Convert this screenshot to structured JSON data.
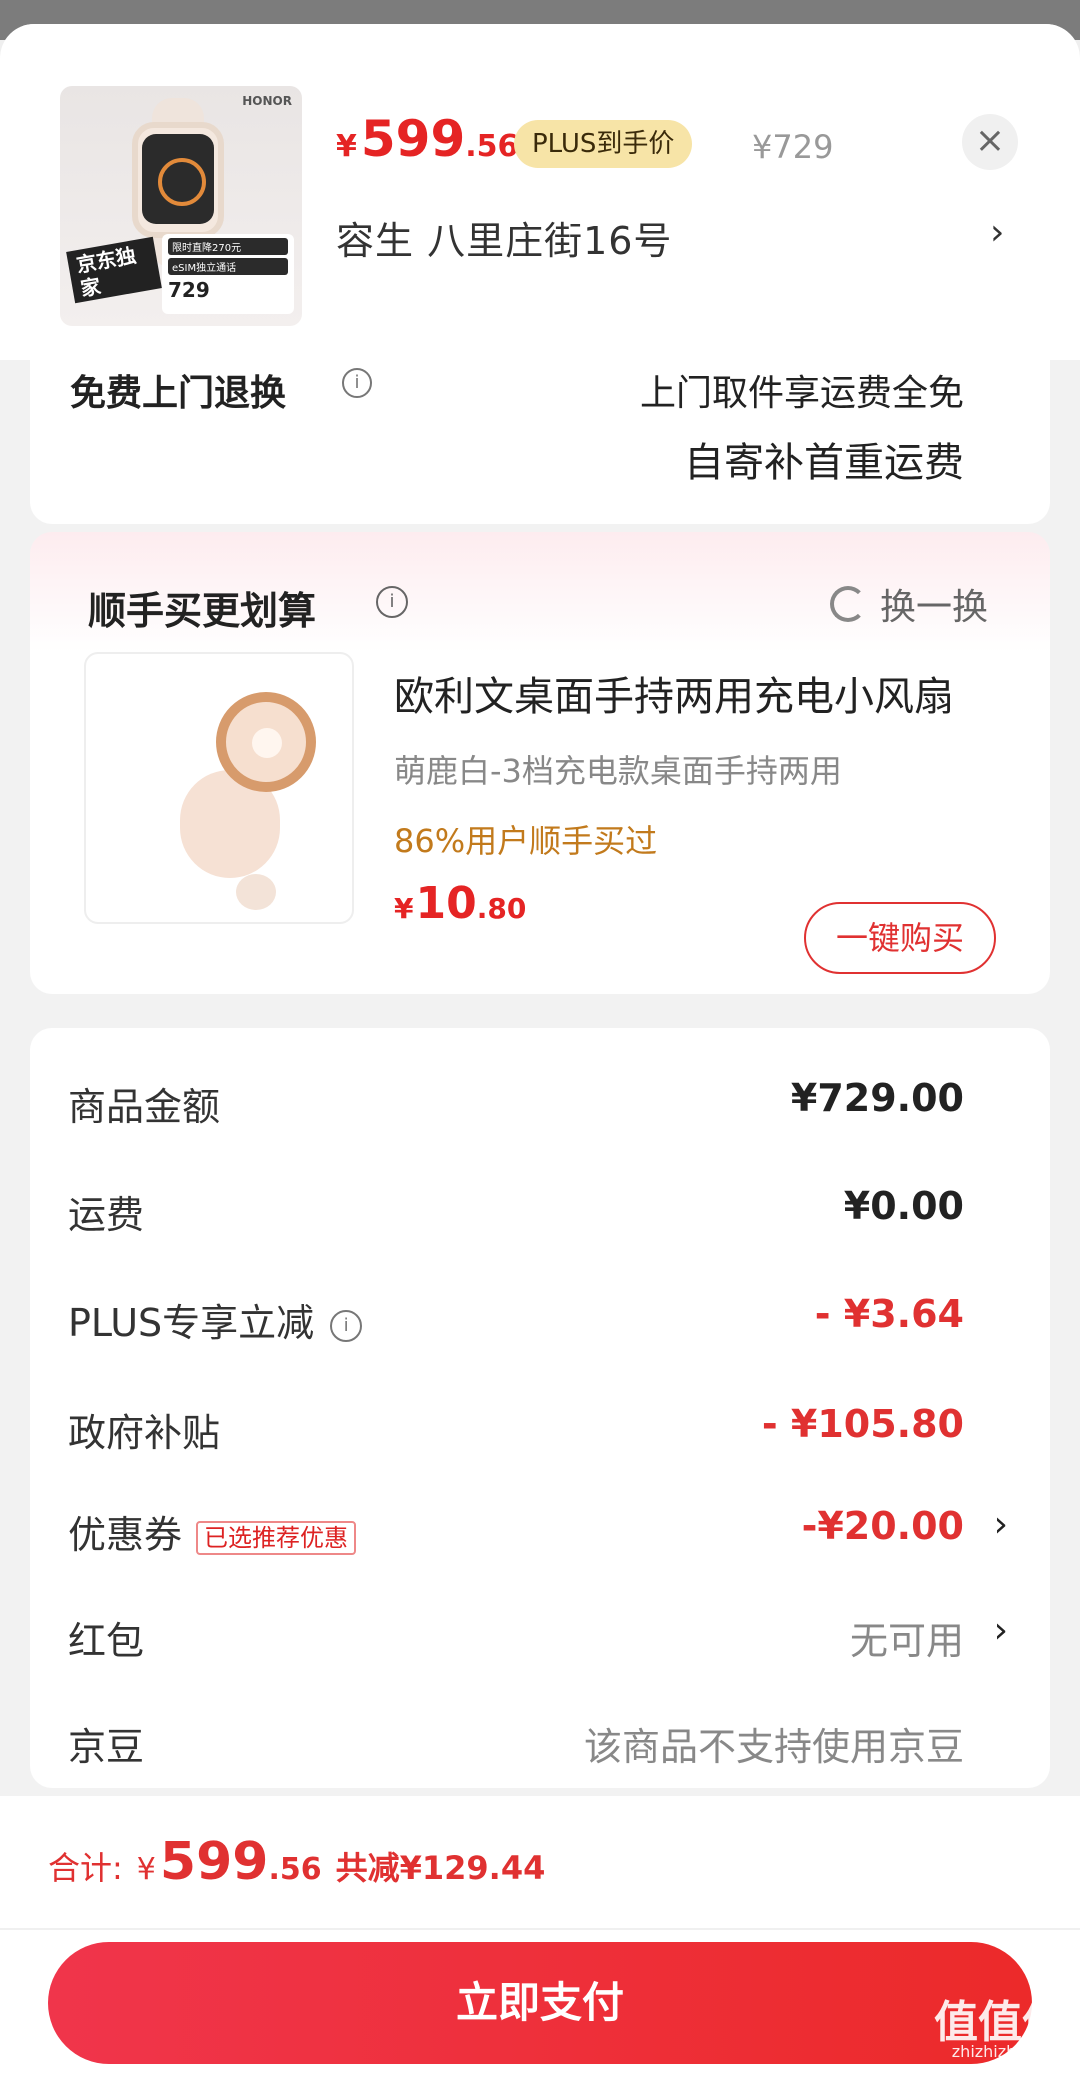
{
  "header": {
    "product_brand": "HONOR",
    "badge_text": "京东独家",
    "promo_line": "限时直降270元",
    "promo_line2": "eSIM独立通话",
    "promo_price": "729",
    "price_currency": "¥",
    "price_int": "599",
    "price_dec": ".56",
    "plus_tag": "PLUS到手价",
    "original_price": "¥729",
    "address": "容生  八里庄街16号",
    "address_arrow": "›",
    "close_symbol": "×"
  },
  "service": {
    "label": "免费上门退换",
    "line1": "上门取件享运费全免",
    "line2": "自寄补首重运费"
  },
  "recommend": {
    "title": "顺手买更划算",
    "refresh_label": "换一换",
    "product_name": "欧利文桌面手持两用充电小风扇",
    "product_sub": "萌鹿白-3档充电款桌面手持两用",
    "product_rate": "86%用户顺手买过",
    "price_currency": "¥",
    "price_int": "10",
    "price_dec": ".80",
    "buy_label": "一键购买"
  },
  "summary": {
    "rows": [
      {
        "label": "商品金额",
        "value": "¥729.00"
      },
      {
        "label": "运费",
        "value": "¥0.00"
      },
      {
        "label": "PLUS专享立减",
        "value": "- ¥3.64"
      },
      {
        "label": "政府补贴",
        "value": "- ¥105.80"
      },
      {
        "label": "优惠券",
        "tag": "已选推荐优惠",
        "value": "-¥20.00"
      },
      {
        "label": "红包",
        "value": "无可用"
      },
      {
        "label": "京豆",
        "value": "该商品不支持使用京豆"
      }
    ]
  },
  "footer": {
    "total_label": "合计:",
    "total_currency": "¥",
    "total_int": "599",
    "total_dec": ".56",
    "saved": "共减¥129.44",
    "pay_label": "立即支付",
    "watermark": "值值值",
    "watermark_sub": "zhizhizhi.com"
  },
  "colors": {
    "accent_red": "#e52424",
    "plus_gold": "#f7e4a7",
    "rate_orange": "#c27a1c"
  }
}
